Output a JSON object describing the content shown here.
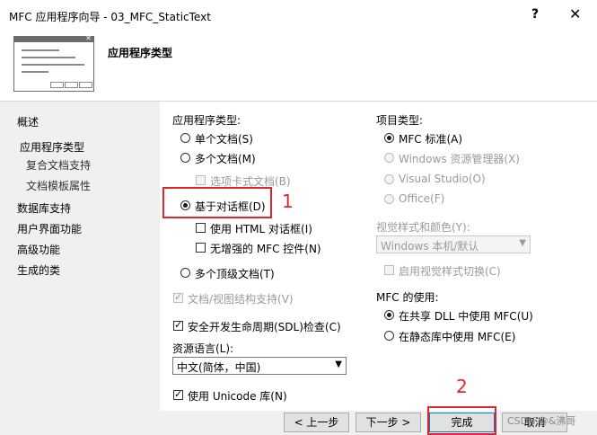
{
  "window": {
    "title": "MFC 应用程序向导 - 03_MFC_StaticText",
    "help": "?",
    "close": "✕"
  },
  "header": {
    "heading": "应用程序类型"
  },
  "nav": [
    {
      "label": "概述"
    },
    {
      "label": "应用程序类型"
    },
    {
      "label": "复合文档支持"
    },
    {
      "label": "文档模板属性"
    },
    {
      "label": "数据库支持"
    },
    {
      "label": "用户界面功能"
    },
    {
      "label": "高级功能"
    },
    {
      "label": "生成的类"
    }
  ],
  "app_type": {
    "group_label": "应用程序类型:",
    "single_doc": "单个文档(S)",
    "multi_doc": "多个文档(M)",
    "tabbed_docs": "选项卡式文档(B)",
    "dialog_based": "基于对话框(D)",
    "use_html_dialog": "使用 HTML 对话框(I)",
    "no_enhanced_controls": "无增强的 MFC 控件(N)",
    "multi_toplevel": "多个顶级文档(T)",
    "doc_view_support": "文档/视图结构支持(V)",
    "sdl_checks": "安全开发生命周期(SDL)检查(C)",
    "resource_lang_label": "资源语言(L):",
    "resource_lang_value": "中文(简体，中国)",
    "use_unicode": "使用 Unicode 库(N)"
  },
  "project_type": {
    "group_label": "项目类型:",
    "mfc_standard": "MFC 标准(A)",
    "windows_explorer": "Windows 资源管理器(X)",
    "visual_studio": "Visual Studio(O)",
    "office": "Office(F)"
  },
  "visual_style": {
    "label": "视觉样式和颜色(Y):",
    "value": "Windows 本机/默认",
    "enable_switching": "启用视觉样式切换(C)"
  },
  "mfc_use": {
    "label": "MFC 的使用:",
    "shared_dll": "在共享 DLL 中使用 MFC(U)",
    "static_lib": "在静态库中使用 MFC(E)"
  },
  "annotations": {
    "one": "1",
    "two": "2"
  },
  "buttons": {
    "prev": "< 上一步",
    "next": "下一步 >",
    "finish": "完成",
    "cancel": "取消"
  },
  "watermark": "CSDN @&沸哥",
  "colors": {
    "annotation_red": "#e0262b"
  }
}
